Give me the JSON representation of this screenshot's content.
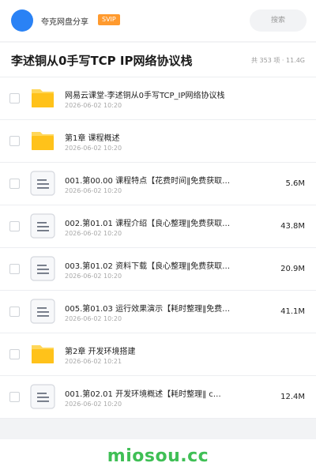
{
  "topbar": {
    "site_name": "夸克网盘分享",
    "badge": "SVIP",
    "search_placeholder": "搜索"
  },
  "header": {
    "title": "李述铜从0手写TCP IP网络协议栈",
    "meta": "共 353 项 · 11.4G"
  },
  "files": [
    {
      "type": "folder",
      "name": "网易云课堂-李述铜从0手写TCP_IP网络协议栈",
      "date": "2026-06-02 10:20",
      "size": ""
    },
    {
      "type": "folder",
      "name": "第1章 课程概述",
      "date": "2026-06-02 10:20",
      "size": ""
    },
    {
      "type": "file",
      "name": "001.第00.00 课程特点【花费时间‖免费获取…",
      "date": "2026-06-02 10:20",
      "size": "5.6M"
    },
    {
      "type": "file",
      "name": "002.第01.01 课程介绍【良心整理‖免费获取…",
      "date": "2026-06-02 10:20",
      "size": "43.8M"
    },
    {
      "type": "file",
      "name": "003.第01.02 资料下载【良心整理‖免费获取…",
      "date": "2026-06-02 10:20",
      "size": "20.9M"
    },
    {
      "type": "file",
      "name": "005.第01.03 运行效果演示【耗时整理‖免费…",
      "date": "2026-06-02 10:20",
      "size": "41.1M"
    },
    {
      "type": "folder",
      "name": "第2章 开发环境搭建",
      "date": "2026-06-02 10:21",
      "size": ""
    },
    {
      "type": "file",
      "name": "001.第02.01 开发环境概述【耗时整理‖ c…",
      "date": "2026-06-02 10:20",
      "size": "12.4M"
    }
  ],
  "watermark": "miosou.cc",
  "colors": {
    "accent": "#2a82f5",
    "folder": "#ffc21a",
    "badge": "#ff9a2e",
    "watermark": "#3fbf55"
  }
}
